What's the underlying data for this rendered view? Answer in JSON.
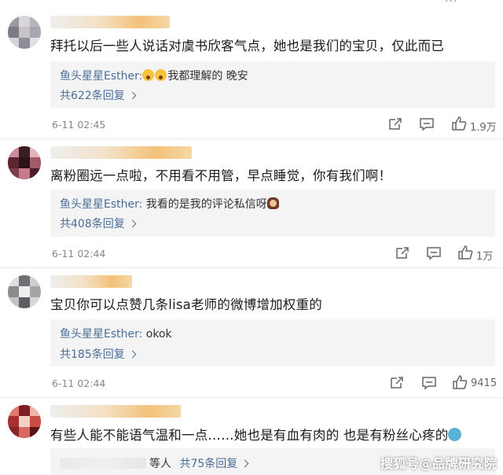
{
  "top": {
    "more_icon": "more-dots-icon",
    "dots": "···"
  },
  "comments": [
    {
      "text": "拜托以后一些人说话对虞书欣客气点，她也是我们的宝贝，仅此而已",
      "reply": {
        "user": "鱼头星星Esther:",
        "emoji": [
          "shocked-face-emoji",
          "shocked-face-emoji"
        ],
        "content": "我都理解的 晚安"
      },
      "reply_count": "共622条回复",
      "time": "6-11 02:45",
      "likes": "1.9万"
    },
    {
      "text": "离粉圈远一点啦，不用看不用管，早点睡觉，你有我们啊！",
      "reply": {
        "user": "鱼头星星Esther:",
        "content": " 我看的是我的评论私信呀",
        "emoji": [
          "girl-gesture-emoji"
        ]
      },
      "reply_count": "共408条回复",
      "time": "6-11 02:44",
      "likes": "1万"
    },
    {
      "text": "宝贝你可以点赞几条lisa老师的微博增加权重的",
      "reply": {
        "user": "鱼头星星Esther:",
        "content": " okok"
      },
      "reply_count": "共185条回复",
      "time": "6-11 02:44",
      "likes": "9415"
    },
    {
      "text": "有些人能不能语气温和一点……她也是有血有肉的 也是有粉丝心疼的",
      "reply": {
        "suffix": "等人",
        "count": "共75条回复"
      },
      "emoji": [
        "sweat-face-emoji"
      ]
    }
  ],
  "watermark": "搜狐号@品牌研究院",
  "colors": {
    "link": "#4a6d97",
    "reply_bg": "#f4f4f4",
    "muted": "#888888"
  }
}
